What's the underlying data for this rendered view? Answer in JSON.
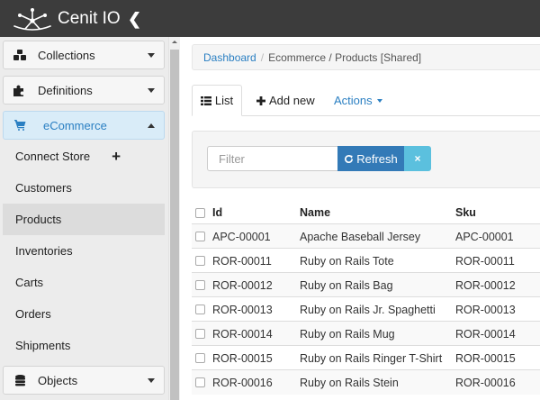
{
  "app": {
    "name": "Cenit IO"
  },
  "sidebar": {
    "groups": [
      {
        "label": "Collections",
        "icon": "cubes-icon"
      },
      {
        "label": "Definitions",
        "icon": "puzzle-icon"
      },
      {
        "label": "eCommerce",
        "icon": "shopping-cart-icon"
      },
      {
        "label": "Objects",
        "icon": "database-icon"
      }
    ],
    "ecommerce_items": [
      {
        "label": "Connect Store"
      },
      {
        "label": "Customers"
      },
      {
        "label": "Products"
      },
      {
        "label": "Inventories"
      },
      {
        "label": "Carts"
      },
      {
        "label": "Orders"
      },
      {
        "label": "Shipments"
      }
    ],
    "selected_item": "Products"
  },
  "breadcrumb": {
    "root": "Dashboard",
    "separator": "/",
    "current": "Ecommerce / Products [Shared]"
  },
  "tabs": {
    "list_label": "List",
    "add_new_label": "Add new",
    "actions_label": "Actions"
  },
  "filter": {
    "placeholder": "Filter",
    "refresh_label": "Refresh",
    "clear_label": "×"
  },
  "table": {
    "columns": {
      "id": "Id",
      "name": "Name",
      "sku": "Sku"
    },
    "rows": [
      {
        "id": "APC-00001",
        "name": "Apache Baseball Jersey",
        "sku": "APC-00001"
      },
      {
        "id": "ROR-00011",
        "name": "Ruby on Rails Tote",
        "sku": "ROR-00011"
      },
      {
        "id": "ROR-00012",
        "name": "Ruby on Rails Bag",
        "sku": "ROR-00012"
      },
      {
        "id": "ROR-00013",
        "name": "Ruby on Rails Jr. Spaghetti",
        "sku": "ROR-00013"
      },
      {
        "id": "ROR-00014",
        "name": "Ruby on Rails Mug",
        "sku": "ROR-00014"
      },
      {
        "id": "ROR-00015",
        "name": "Ruby on Rails Ringer T-Shirt",
        "sku": "ROR-00015"
      },
      {
        "id": "ROR-00016",
        "name": "Ruby on Rails Stein",
        "sku": "ROR-00016"
      }
    ]
  },
  "colors": {
    "topbar": "#3c3c3c",
    "accent": "#2a7fc2",
    "refresh_button": "#337ab7",
    "clear_button": "#5bc0de",
    "active_group": "#d9ecf8"
  }
}
